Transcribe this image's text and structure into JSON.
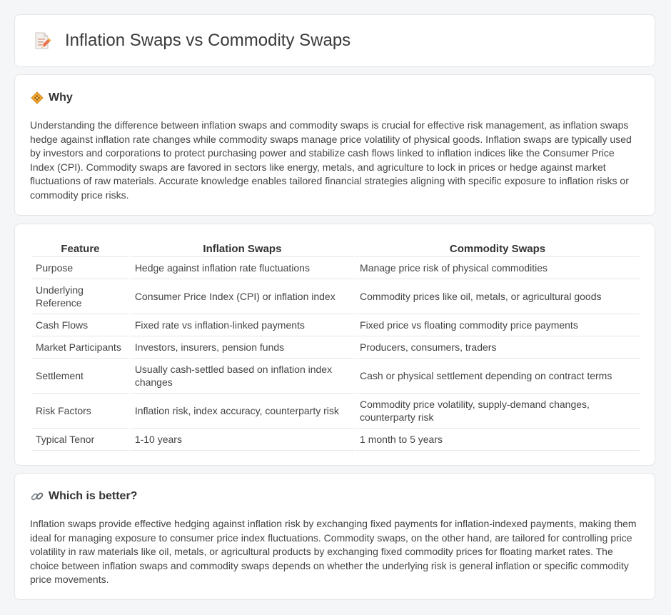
{
  "header": {
    "title": "Inflation Swaps vs Commodity Swaps",
    "icon": "document-pencil-icon"
  },
  "why": {
    "icon": "diamond-sign-icon",
    "title": "Why",
    "text": "Understanding the difference between inflation swaps and commodity swaps is crucial for effective risk management, as inflation swaps hedge against inflation rate changes while commodity swaps manage price volatility of physical goods. Inflation swaps are typically used by investors and corporations to protect purchasing power and stabilize cash flows linked to inflation indices like the Consumer Price Index (CPI). Commodity swaps are favored in sectors like energy, metals, and agriculture to lock in prices or hedge against market fluctuations of raw materials. Accurate knowledge enables tailored financial strategies aligning with specific exposure to inflation risks or commodity price risks."
  },
  "table": {
    "headers": [
      "Feature",
      "Inflation Swaps",
      "Commodity Swaps"
    ],
    "rows": [
      [
        "Purpose",
        "Hedge against inflation rate fluctuations",
        "Manage price risk of physical commodities"
      ],
      [
        "Underlying Reference",
        "Consumer Price Index (CPI) or inflation index",
        "Commodity prices like oil, metals, or agricultural goods"
      ],
      [
        "Cash Flows",
        "Fixed rate vs inflation-linked payments",
        "Fixed price vs floating commodity price payments"
      ],
      [
        "Market Participants",
        "Investors, insurers, pension funds",
        "Producers, consumers, traders"
      ],
      [
        "Settlement",
        "Usually cash-settled based on inflation index changes",
        "Cash or physical settlement depending on contract terms"
      ],
      [
        "Risk Factors",
        "Inflation risk, index accuracy, counterparty risk",
        "Commodity price volatility, supply-demand changes, counterparty risk"
      ],
      [
        "Typical Tenor",
        "1-10 years",
        "1 month to 5 years"
      ]
    ]
  },
  "better": {
    "icon": "link-icon",
    "title": "Which is better?",
    "text": "Inflation swaps provide effective hedging against inflation risk by exchanging fixed payments for inflation-indexed payments, making them ideal for managing exposure to consumer price index fluctuations. Commodity swaps, on the other hand, are tailored for controlling price volatility in raw materials like oil, metals, or agricultural products by exchanging fixed commodity prices for floating market rates. The choice between inflation swaps and commodity swaps depends on whether the underlying risk is general inflation or specific commodity price movements."
  }
}
